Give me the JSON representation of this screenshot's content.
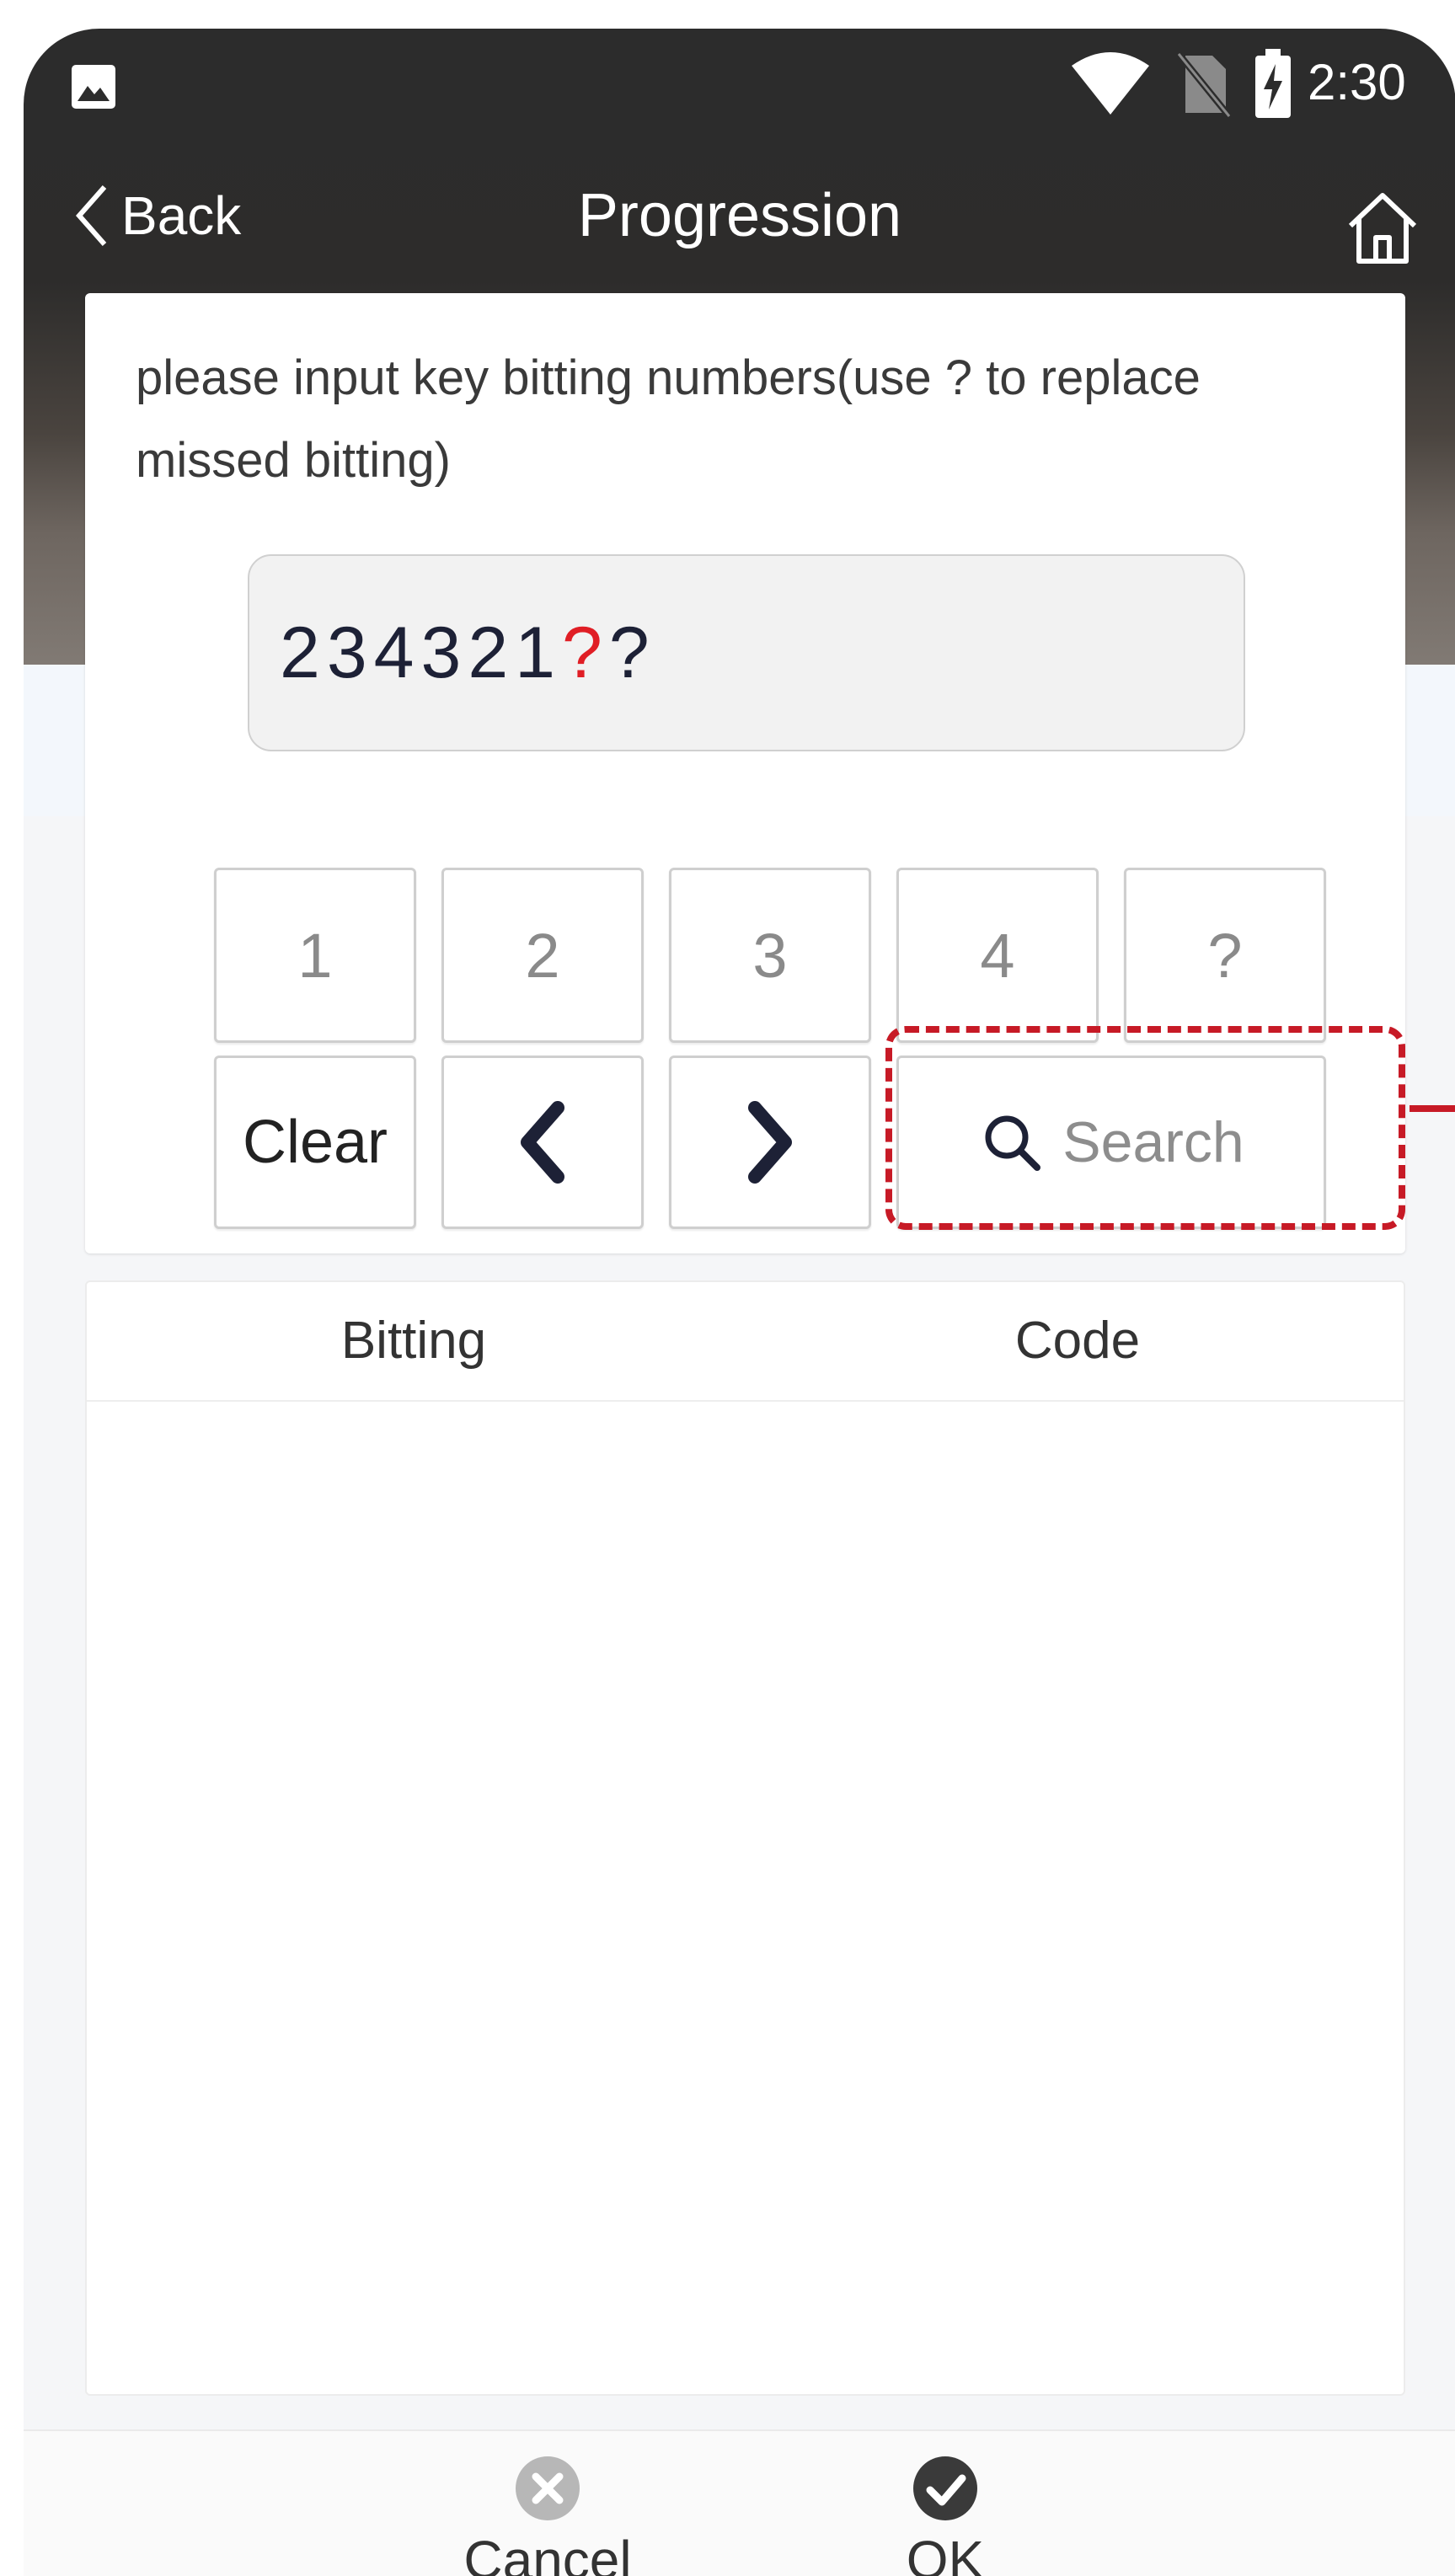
{
  "status_bar": {
    "time": "2:30",
    "icons": [
      "gallery-icon",
      "wifi-icon",
      "no-sim-icon",
      "battery-charging-icon"
    ]
  },
  "header": {
    "back_label": "Back",
    "title": "Progression",
    "home_icon": "home-icon"
  },
  "input": {
    "prompt": "please input key bitting numbers(use ? to replace missed bitting)",
    "value_prefix": "234321",
    "value_current": "?",
    "value_suffix": "?"
  },
  "keypad": {
    "row1": [
      "1",
      "2",
      "3",
      "4",
      "?"
    ],
    "clear_label": "Clear",
    "left_icon": "chevron-left-icon",
    "right_icon": "chevron-right-icon",
    "search_label": "Search"
  },
  "results": {
    "columns": [
      "Bitting",
      "Code"
    ],
    "rows": []
  },
  "bottom_bar": {
    "cancel_label": "Cancel",
    "ok_label": "OK"
  },
  "colors": {
    "header_dark": "#2c2c2c",
    "accent_red": "#e01e25",
    "highlight_red": "#c71a26",
    "key_border": "#cfcfcf"
  }
}
